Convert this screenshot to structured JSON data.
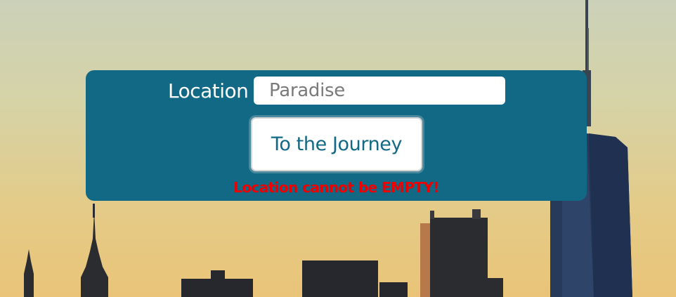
{
  "form": {
    "location_label": "Location",
    "location_value": "Paradise",
    "location_placeholder": "Paradise",
    "submit_label": "To the Journey",
    "error_message": "Location cannot be EMPTY!"
  },
  "colors": {
    "panel": "#126985",
    "button_text": "#126985",
    "error": "#ee0000"
  },
  "background": {
    "description_icon": "city-skyline-background"
  }
}
